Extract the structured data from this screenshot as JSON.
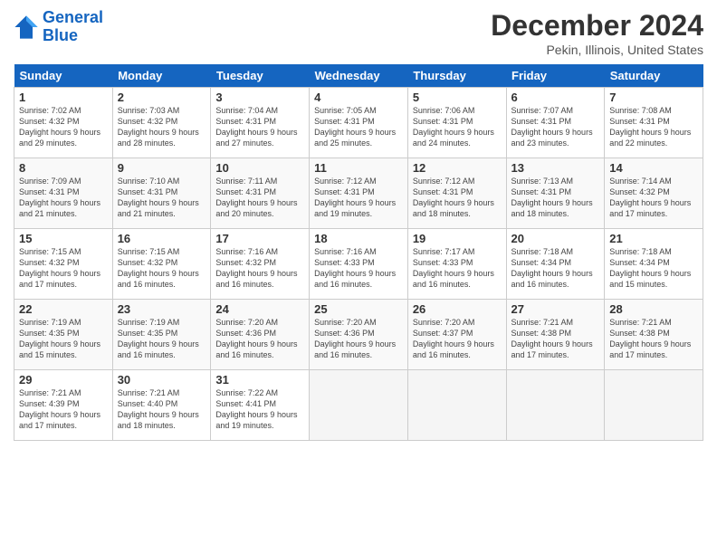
{
  "header": {
    "logo_line1": "General",
    "logo_line2": "Blue",
    "month": "December 2024",
    "location": "Pekin, Illinois, United States"
  },
  "weekdays": [
    "Sunday",
    "Monday",
    "Tuesday",
    "Wednesday",
    "Thursday",
    "Friday",
    "Saturday"
  ],
  "weeks": [
    [
      {
        "day": "1",
        "sunrise": "7:02 AM",
        "sunset": "4:32 PM",
        "daylight": "9 hours and 29 minutes."
      },
      {
        "day": "2",
        "sunrise": "7:03 AM",
        "sunset": "4:32 PM",
        "daylight": "9 hours and 28 minutes."
      },
      {
        "day": "3",
        "sunrise": "7:04 AM",
        "sunset": "4:31 PM",
        "daylight": "9 hours and 27 minutes."
      },
      {
        "day": "4",
        "sunrise": "7:05 AM",
        "sunset": "4:31 PM",
        "daylight": "9 hours and 25 minutes."
      },
      {
        "day": "5",
        "sunrise": "7:06 AM",
        "sunset": "4:31 PM",
        "daylight": "9 hours and 24 minutes."
      },
      {
        "day": "6",
        "sunrise": "7:07 AM",
        "sunset": "4:31 PM",
        "daylight": "9 hours and 23 minutes."
      },
      {
        "day": "7",
        "sunrise": "7:08 AM",
        "sunset": "4:31 PM",
        "daylight": "9 hours and 22 minutes."
      }
    ],
    [
      {
        "day": "8",
        "sunrise": "7:09 AM",
        "sunset": "4:31 PM",
        "daylight": "9 hours and 21 minutes."
      },
      {
        "day": "9",
        "sunrise": "7:10 AM",
        "sunset": "4:31 PM",
        "daylight": "9 hours and 21 minutes."
      },
      {
        "day": "10",
        "sunrise": "7:11 AM",
        "sunset": "4:31 PM",
        "daylight": "9 hours and 20 minutes."
      },
      {
        "day": "11",
        "sunrise": "7:12 AM",
        "sunset": "4:31 PM",
        "daylight": "9 hours and 19 minutes."
      },
      {
        "day": "12",
        "sunrise": "7:12 AM",
        "sunset": "4:31 PM",
        "daylight": "9 hours and 18 minutes."
      },
      {
        "day": "13",
        "sunrise": "7:13 AM",
        "sunset": "4:31 PM",
        "daylight": "9 hours and 18 minutes."
      },
      {
        "day": "14",
        "sunrise": "7:14 AM",
        "sunset": "4:32 PM",
        "daylight": "9 hours and 17 minutes."
      }
    ],
    [
      {
        "day": "15",
        "sunrise": "7:15 AM",
        "sunset": "4:32 PM",
        "daylight": "9 hours and 17 minutes."
      },
      {
        "day": "16",
        "sunrise": "7:15 AM",
        "sunset": "4:32 PM",
        "daylight": "9 hours and 16 minutes."
      },
      {
        "day": "17",
        "sunrise": "7:16 AM",
        "sunset": "4:32 PM",
        "daylight": "9 hours and 16 minutes."
      },
      {
        "day": "18",
        "sunrise": "7:16 AM",
        "sunset": "4:33 PM",
        "daylight": "9 hours and 16 minutes."
      },
      {
        "day": "19",
        "sunrise": "7:17 AM",
        "sunset": "4:33 PM",
        "daylight": "9 hours and 16 minutes."
      },
      {
        "day": "20",
        "sunrise": "7:18 AM",
        "sunset": "4:34 PM",
        "daylight": "9 hours and 16 minutes."
      },
      {
        "day": "21",
        "sunrise": "7:18 AM",
        "sunset": "4:34 PM",
        "daylight": "9 hours and 15 minutes."
      }
    ],
    [
      {
        "day": "22",
        "sunrise": "7:19 AM",
        "sunset": "4:35 PM",
        "daylight": "9 hours and 15 minutes."
      },
      {
        "day": "23",
        "sunrise": "7:19 AM",
        "sunset": "4:35 PM",
        "daylight": "9 hours and 16 minutes."
      },
      {
        "day": "24",
        "sunrise": "7:20 AM",
        "sunset": "4:36 PM",
        "daylight": "9 hours and 16 minutes."
      },
      {
        "day": "25",
        "sunrise": "7:20 AM",
        "sunset": "4:36 PM",
        "daylight": "9 hours and 16 minutes."
      },
      {
        "day": "26",
        "sunrise": "7:20 AM",
        "sunset": "4:37 PM",
        "daylight": "9 hours and 16 minutes."
      },
      {
        "day": "27",
        "sunrise": "7:21 AM",
        "sunset": "4:38 PM",
        "daylight": "9 hours and 17 minutes."
      },
      {
        "day": "28",
        "sunrise": "7:21 AM",
        "sunset": "4:38 PM",
        "daylight": "9 hours and 17 minutes."
      }
    ],
    [
      {
        "day": "29",
        "sunrise": "7:21 AM",
        "sunset": "4:39 PM",
        "daylight": "9 hours and 17 minutes."
      },
      {
        "day": "30",
        "sunrise": "7:21 AM",
        "sunset": "4:40 PM",
        "daylight": "9 hours and 18 minutes."
      },
      {
        "day": "31",
        "sunrise": "7:22 AM",
        "sunset": "4:41 PM",
        "daylight": "9 hours and 19 minutes."
      },
      null,
      null,
      null,
      null
    ]
  ]
}
